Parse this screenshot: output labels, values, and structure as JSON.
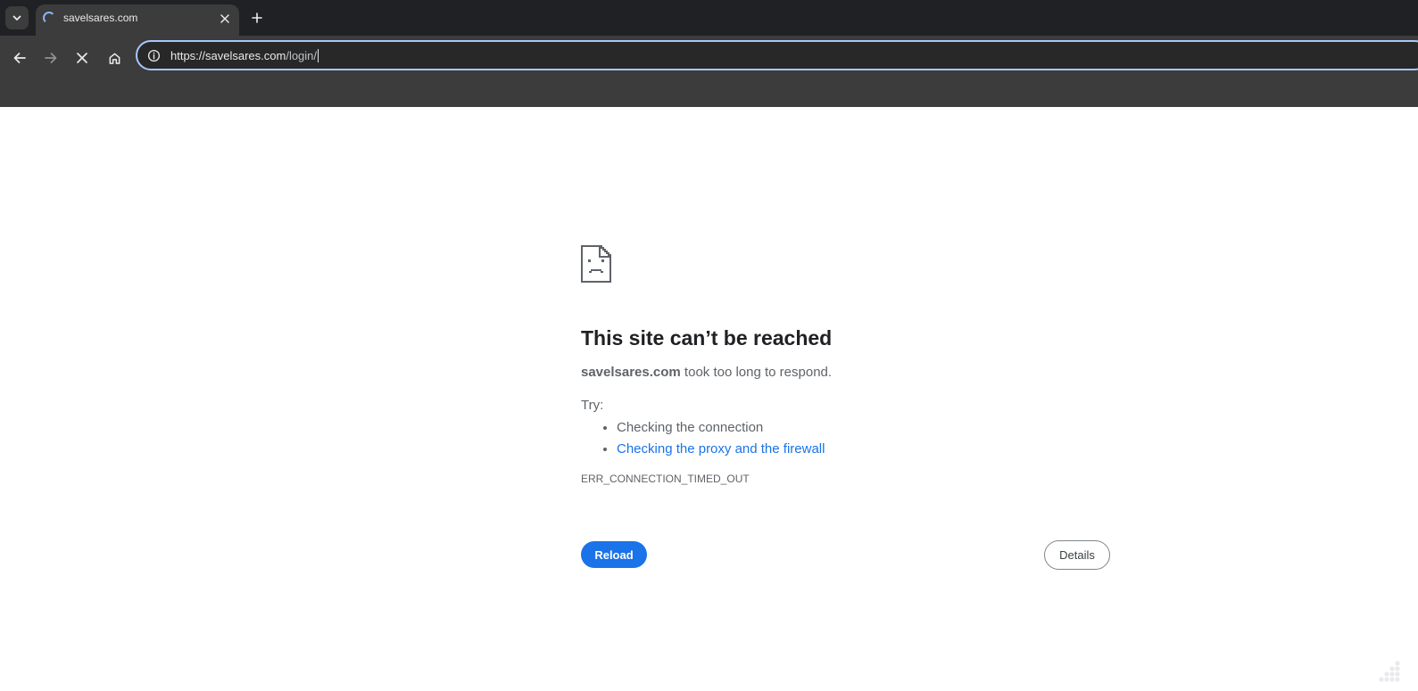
{
  "tabstrip": {
    "tab_title": "savelsares.com",
    "new_tab_label": "+"
  },
  "omnibox": {
    "url_host": "https://savelsares.com",
    "url_path": "/login/"
  },
  "error": {
    "title": "This site can’t be reached",
    "host": "savelsares.com",
    "message": " took too long to respond.",
    "try_label": "Try:",
    "suggestions": [
      {
        "text": "Checking the connection",
        "link": false
      },
      {
        "text": "Checking the proxy and the firewall",
        "link": true
      }
    ],
    "code": "ERR_CONNECTION_TIMED_OUT",
    "reload_label": "Reload",
    "details_label": "Details"
  },
  "colors": {
    "accent": "#1a73e8",
    "chrome_dark": "#202124",
    "toolbar": "#3c3c3c",
    "omnibox_focus": "#a8c7fa"
  }
}
